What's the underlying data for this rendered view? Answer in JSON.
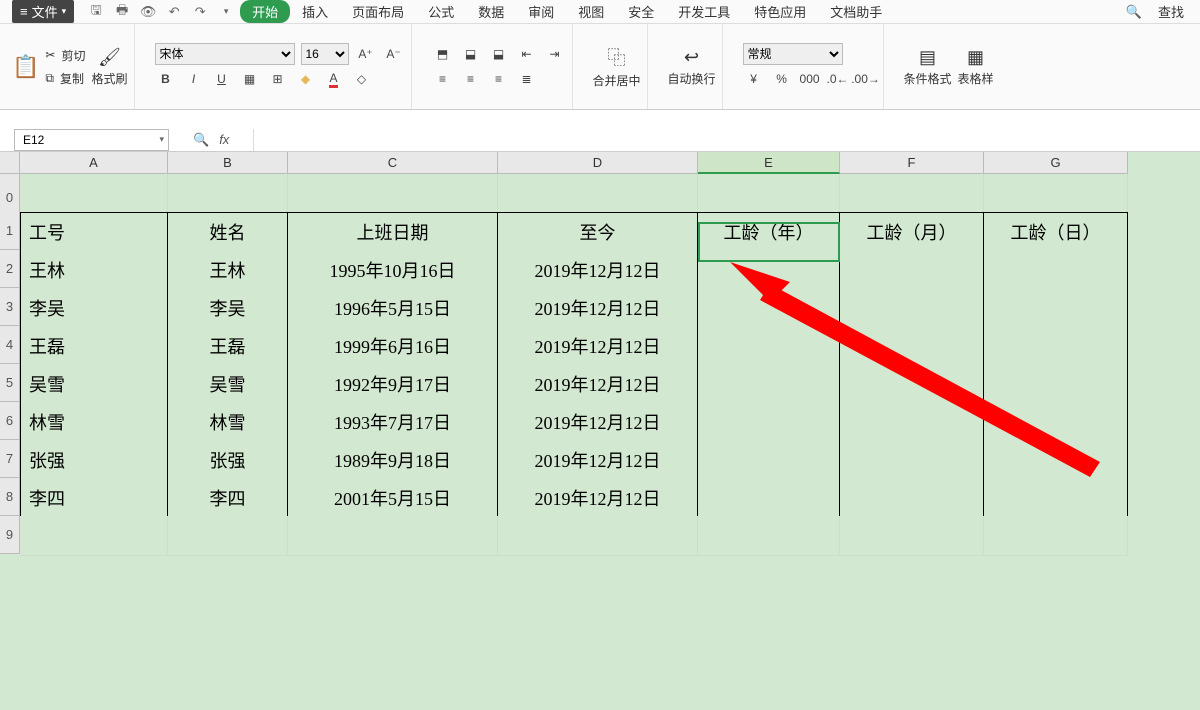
{
  "menu": {
    "file": "文件",
    "tabs": [
      "开始",
      "插入",
      "页面布局",
      "公式",
      "数据",
      "审阅",
      "视图",
      "安全",
      "开发工具",
      "特色应用",
      "文档助手"
    ],
    "active": 0,
    "search": "查找"
  },
  "qat": [
    "save",
    "print",
    "preview",
    "undo",
    "redo"
  ],
  "ribbon": {
    "paste": "格式刷",
    "cut": "剪切",
    "copy": "复制",
    "font_name": "宋体",
    "font_size": "16",
    "bold": "B",
    "italic": "I",
    "underline": "U",
    "merge": "合并居中",
    "wrap": "自动换行",
    "number_format": "常规",
    "cond": "条件格式",
    "tablestyle": "表格样"
  },
  "name_box": "E12",
  "columns": [
    "A",
    "B",
    "C",
    "D",
    "E",
    "F",
    "G"
  ],
  "table": {
    "headers": [
      "工号",
      "姓名",
      "上班日期",
      "至今",
      "工龄（年）",
      "工龄（月）",
      "工龄（日）"
    ],
    "rows": [
      {
        "a": "王林",
        "b": "王林",
        "c": "1995年10月16日",
        "d": "2019年12月12日"
      },
      {
        "a": "李吴",
        "b": "李吴",
        "c": "1996年5月15日",
        "d": "2019年12月12日"
      },
      {
        "a": "王磊",
        "b": "王磊",
        "c": "1999年6月16日",
        "d": "2019年12月12日"
      },
      {
        "a": "吴雪",
        "b": "吴雪",
        "c": "1992年9月17日",
        "d": "2019年12月12日"
      },
      {
        "a": "林雪",
        "b": "林雪",
        "c": "1993年7月17日",
        "d": "2019年12月12日"
      },
      {
        "a": "张强",
        "b": "张强",
        "c": "1989年9月18日",
        "d": "2019年12月12日"
      },
      {
        "a": "李四",
        "b": "李四",
        "c": "2001年5月15日",
        "d": "2019年12月12日"
      }
    ]
  },
  "row_numbers": [
    "0",
    "1",
    "2",
    "3",
    "4",
    "5",
    "6",
    "7",
    "8",
    "9"
  ],
  "selected_cell": {
    "col": "E",
    "row": 2
  }
}
